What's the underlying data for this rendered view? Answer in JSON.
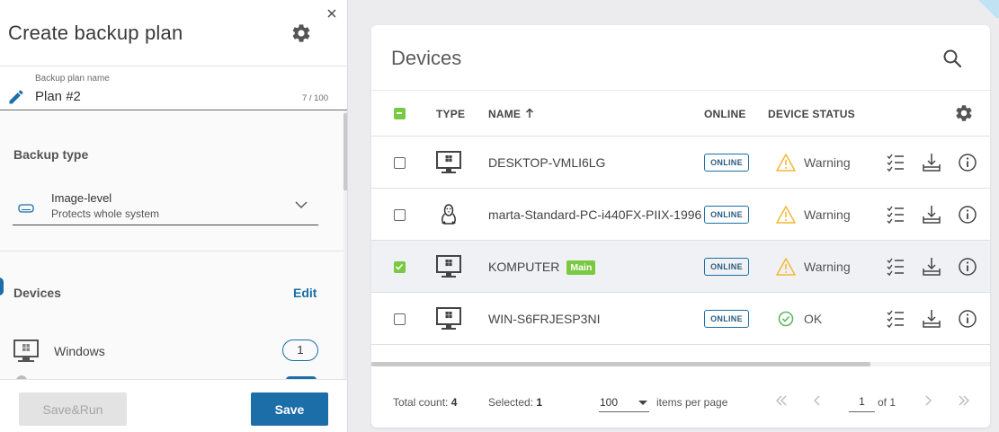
{
  "panel": {
    "title": "Create backup plan",
    "plan_name_label": "Backup plan name",
    "plan_name_value": "Plan #2",
    "plan_name_count": "7 / 100",
    "backup_type_label": "Backup type",
    "backup_type_title": "Image-level",
    "backup_type_sub": "Protects whole system",
    "devices_label": "Devices",
    "edit_label": "Edit",
    "os_items": [
      {
        "label": "Windows",
        "count": "1",
        "icon": "monitor-windows-icon"
      }
    ],
    "save_run_label": "Save&Run",
    "save_label": "Save"
  },
  "devices": {
    "title": "Devices",
    "columns": {
      "type": "TYPE",
      "name": "NAME",
      "online": "ONLINE",
      "status": "DEVICE STATUS"
    },
    "rows": [
      {
        "name": "DESKTOP-VMLI6LG",
        "os": "windows",
        "online": "ONLINE",
        "status": "Warning",
        "selected": false,
        "badge": ""
      },
      {
        "name": "marta-Standard-PC-i440FX-PIIX-1996",
        "os": "linux",
        "online": "ONLINE",
        "status": "Warning",
        "selected": false,
        "badge": ""
      },
      {
        "name": "KOMPUTER",
        "os": "windows",
        "online": "ONLINE",
        "status": "Warning",
        "selected": true,
        "badge": "Main"
      },
      {
        "name": "WIN-S6FRJESP3NI",
        "os": "windows",
        "online": "ONLINE",
        "status": "OK",
        "selected": false,
        "badge": ""
      }
    ],
    "pager": {
      "total_label": "Total count:",
      "total": "4",
      "selected_label": "Selected:",
      "selected": "1",
      "per_page": "100",
      "per_page_label": "items per page",
      "page": "1",
      "of_label": "of 1"
    }
  },
  "colors": {
    "accent": "#1b6ea8",
    "green": "#7ac943",
    "warning": "#f5b731",
    "ok": "#5cb85c"
  }
}
